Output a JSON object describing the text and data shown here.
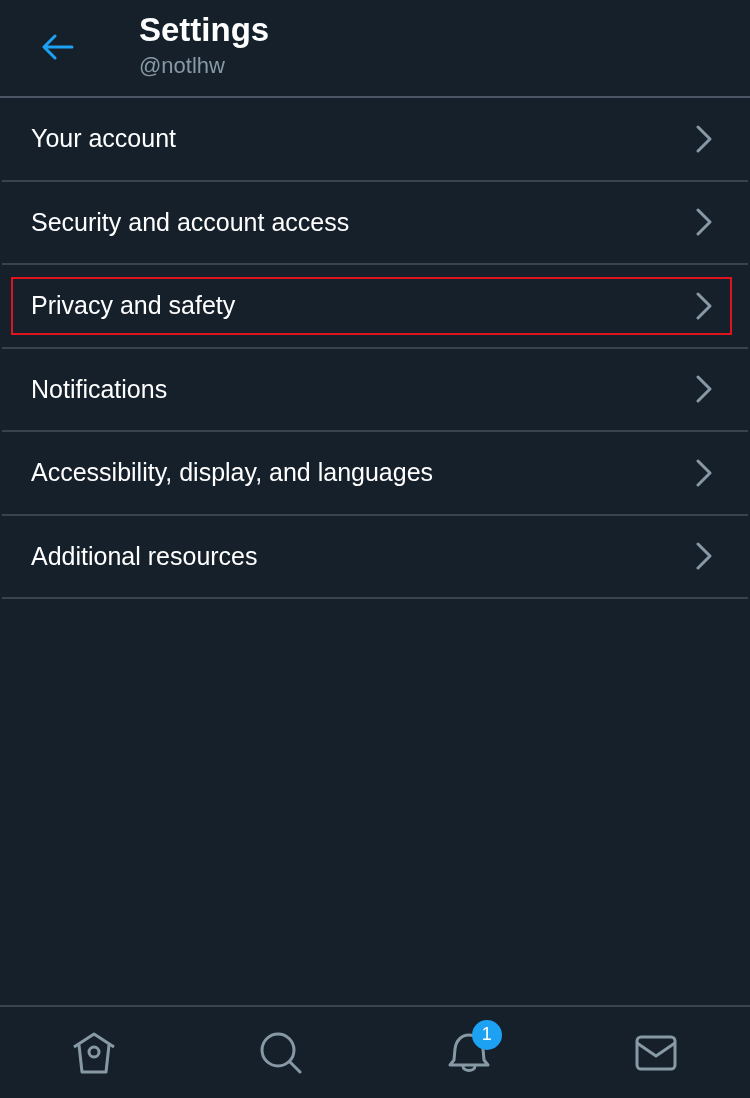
{
  "header": {
    "title": "Settings",
    "handle": "@notlhw"
  },
  "menu": [
    {
      "label": "Your account",
      "highlighted": false
    },
    {
      "label": "Security and account access",
      "highlighted": false
    },
    {
      "label": "Privacy and safety",
      "highlighted": true
    },
    {
      "label": "Notifications",
      "highlighted": false
    },
    {
      "label": "Accessibility, display, and languages",
      "highlighted": false
    },
    {
      "label": "Additional resources",
      "highlighted": false
    }
  ],
  "tab_bar": [
    {
      "kind": "home"
    },
    {
      "kind": "search"
    },
    {
      "kind": "notifications",
      "badge": "1"
    },
    {
      "kind": "messages"
    }
  ]
}
